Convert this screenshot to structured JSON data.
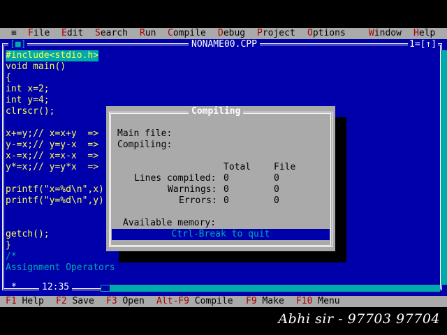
{
  "menu": {
    "system": "≡",
    "items": [
      {
        "hot": "F",
        "rest": "ile"
      },
      {
        "hot": "E",
        "rest": "dit"
      },
      {
        "hot": "S",
        "rest": "earch"
      },
      {
        "hot": "R",
        "rest": "un"
      },
      {
        "hot": "C",
        "rest": "ompile"
      },
      {
        "hot": "D",
        "rest": "ebug"
      },
      {
        "hot": "P",
        "rest": "roject"
      },
      {
        "hot": "O",
        "rest": "ptions"
      },
      {
        "hot": "W",
        "rest": "indow"
      },
      {
        "hot": "H",
        "rest": "elp"
      }
    ]
  },
  "editor": {
    "close_box": "[■]",
    "title": "NONAME00.CPP",
    "window_number": "1=[↑]",
    "code": [
      "#include<stdio.h>",
      "void main()",
      "{",
      "int x=2;",
      "int y=4;",
      "clrscr();",
      "",
      "x+=y;// x=x+y  =>",
      "y-=x;// y=y-x  =>",
      "x-=x;// x=x-x  =>",
      "y*=x;// y=y*x  =>",
      "",
      "printf(\"x=%d\\n\",x)",
      "printf(\"y=%d\\n\",y)",
      "",
      "",
      "getch();",
      "}",
      "/*",
      "Assignment Operators"
    ],
    "status_star": "*",
    "cursor_position": "12:35"
  },
  "dialog": {
    "title": "Compiling",
    "main_file_label": "Main file:",
    "compiling_label": "Compiling:",
    "col_total": "Total",
    "col_file": "File",
    "rows": [
      {
        "label": "Lines compiled:",
        "total": "0",
        "file": "0"
      },
      {
        "label": "Warnings:",
        "total": "0",
        "file": "0"
      },
      {
        "label": "Errors:",
        "total": "0",
        "file": "0"
      }
    ],
    "memory_label": "Available memory:",
    "quit_label": "Ctrl-Break to quit"
  },
  "statusbar": [
    {
      "key": "F1",
      "label": " Help"
    },
    {
      "key": "F2",
      "label": " Save"
    },
    {
      "key": "F3",
      "label": " Open"
    },
    {
      "key": "Alt-F9",
      "label": " Compile"
    },
    {
      "key": "F9",
      "label": " Make"
    },
    {
      "key": "F10",
      "label": " Menu"
    }
  ],
  "watermark": "Abhi sir - 97703 97704",
  "colors": {
    "editor_bg": "#0000aa",
    "menu_bg": "#aaaaaa",
    "hotkey": "#aa0000",
    "code_text": "#ffff55",
    "highlight": "#00aaaa"
  }
}
